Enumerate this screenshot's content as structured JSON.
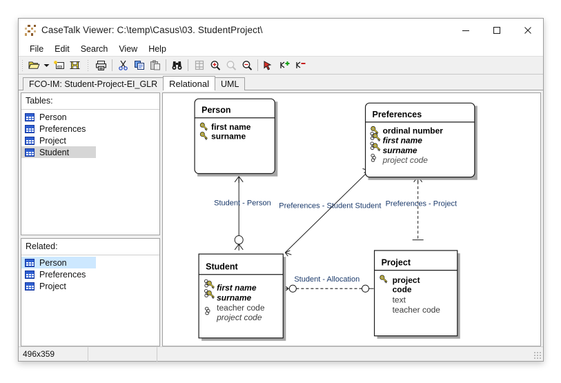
{
  "window": {
    "title": "CaseTalk Viewer: C:\\temp\\Casus\\03. StudentProject\\",
    "app_icon": "casetalk-grid-icon",
    "controls": {
      "minimize": "minimize-icon",
      "maximize": "maximize-icon",
      "close": "close-icon"
    }
  },
  "menubar": {
    "items": [
      {
        "label": "File"
      },
      {
        "label": "Edit"
      },
      {
        "label": "Search"
      },
      {
        "label": "View"
      },
      {
        "label": "Help"
      }
    ]
  },
  "toolbar": {
    "buttons": [
      {
        "name": "open-folder-icon",
        "title": "Open"
      },
      {
        "name": "dropdown-caret-icon",
        "title": "Open recent"
      },
      {
        "name": "new-document-icon",
        "title": "New"
      },
      {
        "name": "save-icon",
        "title": "Save"
      },
      {
        "name": "print-icon",
        "title": "Print"
      },
      {
        "name": "cut-icon",
        "title": "Cut"
      },
      {
        "name": "copy-icon",
        "title": "Copy"
      },
      {
        "name": "paste-icon",
        "title": "Paste"
      },
      {
        "name": "find-binoculars-icon",
        "title": "Find"
      },
      {
        "name": "fit-page-icon",
        "title": "Fit page"
      },
      {
        "name": "zoom-in-icon",
        "title": "Zoom in"
      },
      {
        "name": "zoom-reset-icon",
        "title": "Zoom reset"
      },
      {
        "name": "zoom-out-icon",
        "title": "Zoom out"
      },
      {
        "name": "pointer-select-icon",
        "title": "Select"
      },
      {
        "name": "add-node-icon",
        "title": "Add"
      },
      {
        "name": "remove-node-icon",
        "title": "Remove"
      }
    ]
  },
  "tabs": [
    {
      "label": "FCO-IM: Student-Project-EI_GLR",
      "active": false
    },
    {
      "label": "Relational",
      "active": true
    },
    {
      "label": "UML",
      "active": false
    }
  ],
  "sidebar": {
    "tables": {
      "caption": "Tables:",
      "items": [
        {
          "label": "Person",
          "state": "normal"
        },
        {
          "label": "Preferences",
          "state": "normal"
        },
        {
          "label": "Project",
          "state": "normal"
        },
        {
          "label": "Student",
          "state": "selected-gray"
        }
      ]
    },
    "related": {
      "caption": "Related:",
      "items": [
        {
          "label": "Person",
          "state": "selected-blue"
        },
        {
          "label": "Preferences",
          "state": "normal"
        },
        {
          "label": "Project",
          "state": "normal"
        }
      ]
    }
  },
  "diagram": {
    "entities": [
      {
        "id": "person",
        "title": "Person",
        "attributes": [
          {
            "label": "first name",
            "icon": "key-icon",
            "style": "bold"
          },
          {
            "label": "surname",
            "icon": "key-icon",
            "style": "bold"
          }
        ]
      },
      {
        "id": "preferences",
        "title": "Preferences",
        "attributes": [
          {
            "label": "ordinal number",
            "icon": "key-icon",
            "style": "bold"
          },
          {
            "label": "first name",
            "icon": "key-chain-icon",
            "style": "bold-italic"
          },
          {
            "label": "surname",
            "icon": "key-chain-icon",
            "style": "bold-italic"
          },
          {
            "label": "project code",
            "icon": "chain-icon",
            "style": "italic"
          }
        ]
      },
      {
        "id": "student",
        "title": "Student",
        "attributes": [
          {
            "label": "first name",
            "icon": "key-chain-icon",
            "style": "bold-italic"
          },
          {
            "label": "surname",
            "icon": "key-chain-icon",
            "style": "bold-italic"
          },
          {
            "label": "teacher code",
            "icon": "none",
            "style": "normal"
          },
          {
            "label": "project code",
            "icon": "chain-icon",
            "style": "italic"
          }
        ]
      },
      {
        "id": "project",
        "title": "Project",
        "attributes": [
          {
            "label": "project",
            "icon": "key-icon",
            "style": "bold"
          },
          {
            "label": "code",
            "icon": "none",
            "style": "bold"
          },
          {
            "label": "text",
            "icon": "none",
            "style": "normal"
          },
          {
            "label": "teacher code",
            "icon": "none",
            "style": "normal"
          }
        ]
      }
    ],
    "relationships": [
      {
        "id": "student-person",
        "label": "Student - Person"
      },
      {
        "id": "preferences-student",
        "label": "Preferences - Student Student"
      },
      {
        "id": "preferences-project",
        "label": "Preferences - Project"
      },
      {
        "id": "student-allocation",
        "label": "Student - Allocation"
      }
    ]
  },
  "statusbar": {
    "dimensions": "496x359",
    "cell2": "",
    "cell3": ""
  },
  "colors": {
    "key_yellow": "#f5e03c",
    "selection_gray": "#d6d6d6",
    "selection_blue": "#cde8ff",
    "table_icon_blue": "#2f5fd0",
    "window_chrome": "#f0f0f0"
  }
}
